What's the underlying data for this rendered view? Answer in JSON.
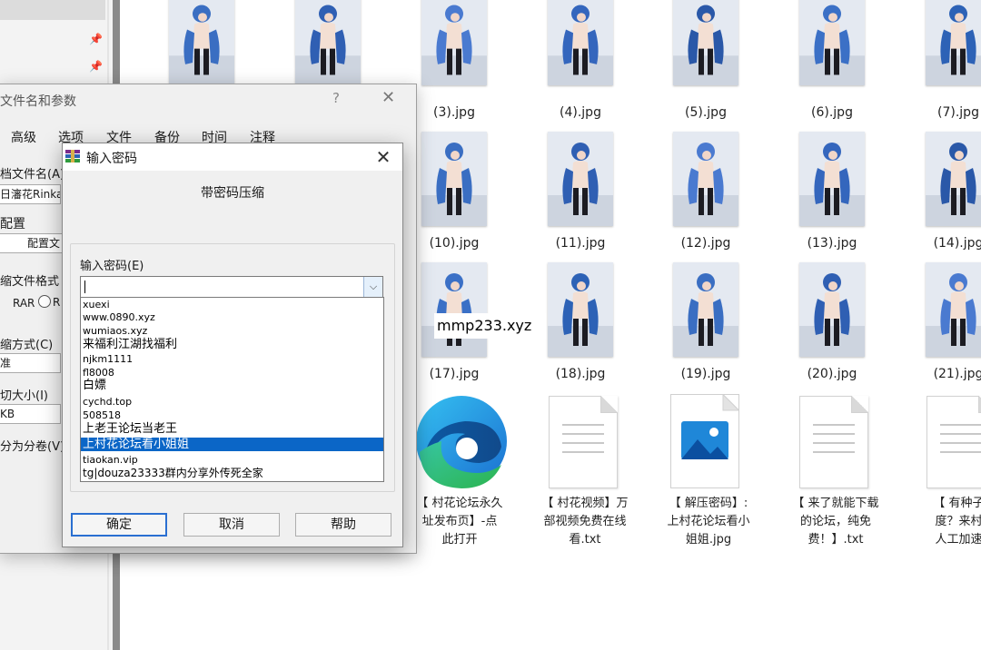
{
  "thumbnails": [
    {
      "label": ""
    },
    {
      "label": ""
    },
    {
      "label": "(3).jpg"
    },
    {
      "label": "(4).jpg"
    },
    {
      "label": "(5).jpg"
    },
    {
      "label": "(6).jpg"
    },
    {
      "label": "(7).jpg"
    },
    {
      "label": "(10).jpg"
    },
    {
      "label": "(11).jpg"
    },
    {
      "label": "(12).jpg"
    },
    {
      "label": "(13).jpg"
    },
    {
      "label": "(14).jpg"
    },
    {
      "label": "(17).jpg"
    },
    {
      "label": "(18).jpg"
    },
    {
      "label": "(19).jpg"
    },
    {
      "label": "(20).jpg"
    },
    {
      "label": "(21).jpg"
    }
  ],
  "files": [
    {
      "lines": [
        "【 村花论坛永久",
        "址发布页】-点",
        "此打开"
      ]
    },
    {
      "lines": [
        "【 村花视频】万",
        "部视频免费在线",
        "看.txt"
      ]
    },
    {
      "lines": [
        "【 解压密码】:",
        "上村花论坛看小",
        "姐姐.jpg"
      ]
    },
    {
      "lines": [
        "【 来了就能下载",
        "的论坛，纯免",
        "费！】.txt"
      ]
    },
    {
      "lines": [
        "【 有种子却",
        "度？来村花",
        "人工加速】"
      ]
    }
  ],
  "overlay_text": "mmp233.xyz",
  "back_dialog": {
    "title": "文件名和参数",
    "help_glyph": "?",
    "tabs": [
      "高级",
      "选项",
      "文件",
      "备份",
      "时间",
      "注释"
    ],
    "labels": {
      "archive_name": "档文件名(A)",
      "archive_value": "日瀋花Rinka",
      "profile": "配置",
      "profile_btn": "配置文",
      "format": "缩文件格式",
      "format_rar": "RAR",
      "format_other": "R",
      "method": "缩方式(C)",
      "method_value": "准",
      "split": "切大小(I)",
      "split_value": "KB",
      "split_vol": "分为分卷(V)"
    }
  },
  "front_dialog": {
    "title": "输入密码",
    "heading": "带密码压缩",
    "password_label": "输入密码(E)",
    "password_value": "",
    "options": [
      "xuexi",
      "www.0890.xyz",
      "wumiaos.xyz",
      "来福利江湖找福利",
      "njkm1111",
      "fl8008",
      "白嫖",
      "cychd.top",
      "508518",
      "上老王论坛当老王",
      "上村花论坛看小姐姐",
      "tiaokan.vip",
      "tg|douza23333群内分享外传死全家"
    ],
    "selected_index": 10,
    "buttons": {
      "ok": "确定",
      "cancel": "取消",
      "help": "帮助"
    }
  }
}
